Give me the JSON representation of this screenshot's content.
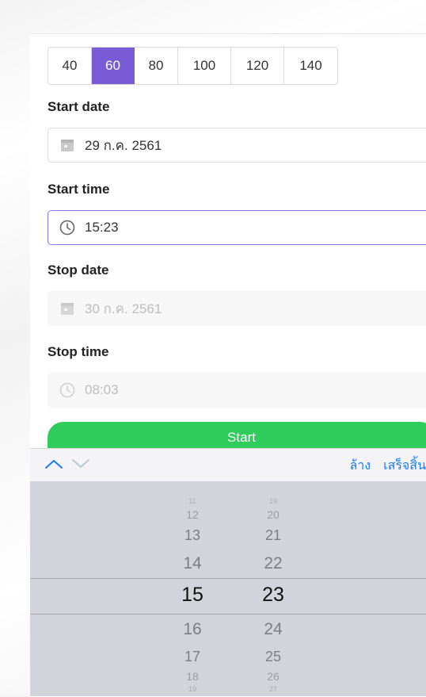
{
  "rate_selector": {
    "options": [
      "40",
      "60",
      "80",
      "100",
      "120",
      "140"
    ],
    "selected": "60",
    "accent_color": "#7a5bd6"
  },
  "start_date": {
    "label": "Start date",
    "value": "29 ก.ค. 2561",
    "icon": "calendar-icon"
  },
  "start_time": {
    "label": "Start time",
    "value": "15:23",
    "icon": "clock-icon"
  },
  "stop_date": {
    "label": "Stop date",
    "value": "30 ก.ค. 2561",
    "icon": "calendar-icon"
  },
  "stop_time": {
    "label": "Stop time",
    "value": "08:03",
    "icon": "clock-icon"
  },
  "start_button": {
    "label": "Start",
    "color": "#2ecc5a"
  },
  "toolbar": {
    "clear_label": "ล้าง",
    "done_label": "เสร็จสิ้น",
    "action_color": "#1a7cf2"
  },
  "picker": {
    "hours": [
      "11",
      "12",
      "13",
      "14",
      "15",
      "16",
      "17",
      "18",
      "19"
    ],
    "minutes": [
      "19",
      "20",
      "21",
      "22",
      "23",
      "24",
      "25",
      "26",
      "27"
    ],
    "selected_hour": "15",
    "selected_minute": "23"
  }
}
